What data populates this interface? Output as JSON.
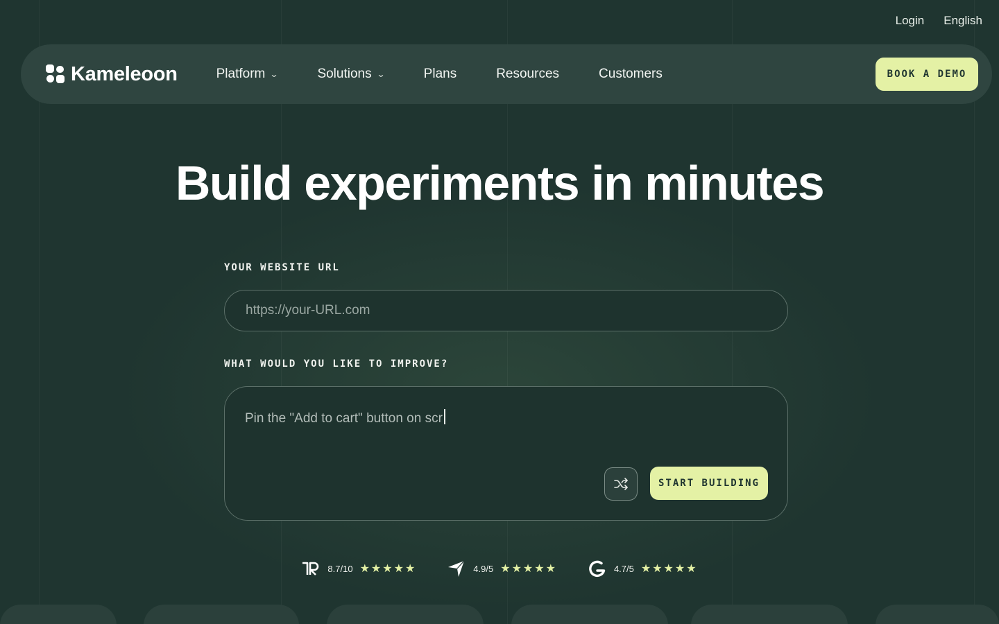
{
  "topbar": {
    "login": "Login",
    "language": "English"
  },
  "nav": {
    "brand": "Kameleoon",
    "items": [
      {
        "label": "Platform",
        "dropdown": true
      },
      {
        "label": "Solutions",
        "dropdown": true
      },
      {
        "label": "Plans",
        "dropdown": false
      },
      {
        "label": "Resources",
        "dropdown": false
      },
      {
        "label": "Customers",
        "dropdown": false
      }
    ],
    "cta": "BOOK A DEMO"
  },
  "hero": {
    "title": "Build experiments in minutes",
    "url_label": "YOUR WEBSITE URL",
    "url_placeholder": "https://your-URL.com",
    "improve_label": "WHAT WOULD YOU LIKE TO IMPROVE?",
    "improve_text": "Pin the \"Add to cart\" button on scr",
    "shuffle_icon": "shuffle-icon",
    "start_button": "START BUILDING"
  },
  "ratings": [
    {
      "source_icon": "trustradius-logo-icon",
      "score": "8.7/10",
      "stars": "★★★★★"
    },
    {
      "source_icon": "capterra-logo-icon",
      "score": "4.9/5",
      "stars": "★★★★★"
    },
    {
      "source_icon": "g2-logo-icon",
      "score": "4.7/5",
      "stars": "★★★★★"
    }
  ],
  "colors": {
    "background": "#1f3530",
    "nav": "#2f4540",
    "accent": "#e4f1a5"
  }
}
